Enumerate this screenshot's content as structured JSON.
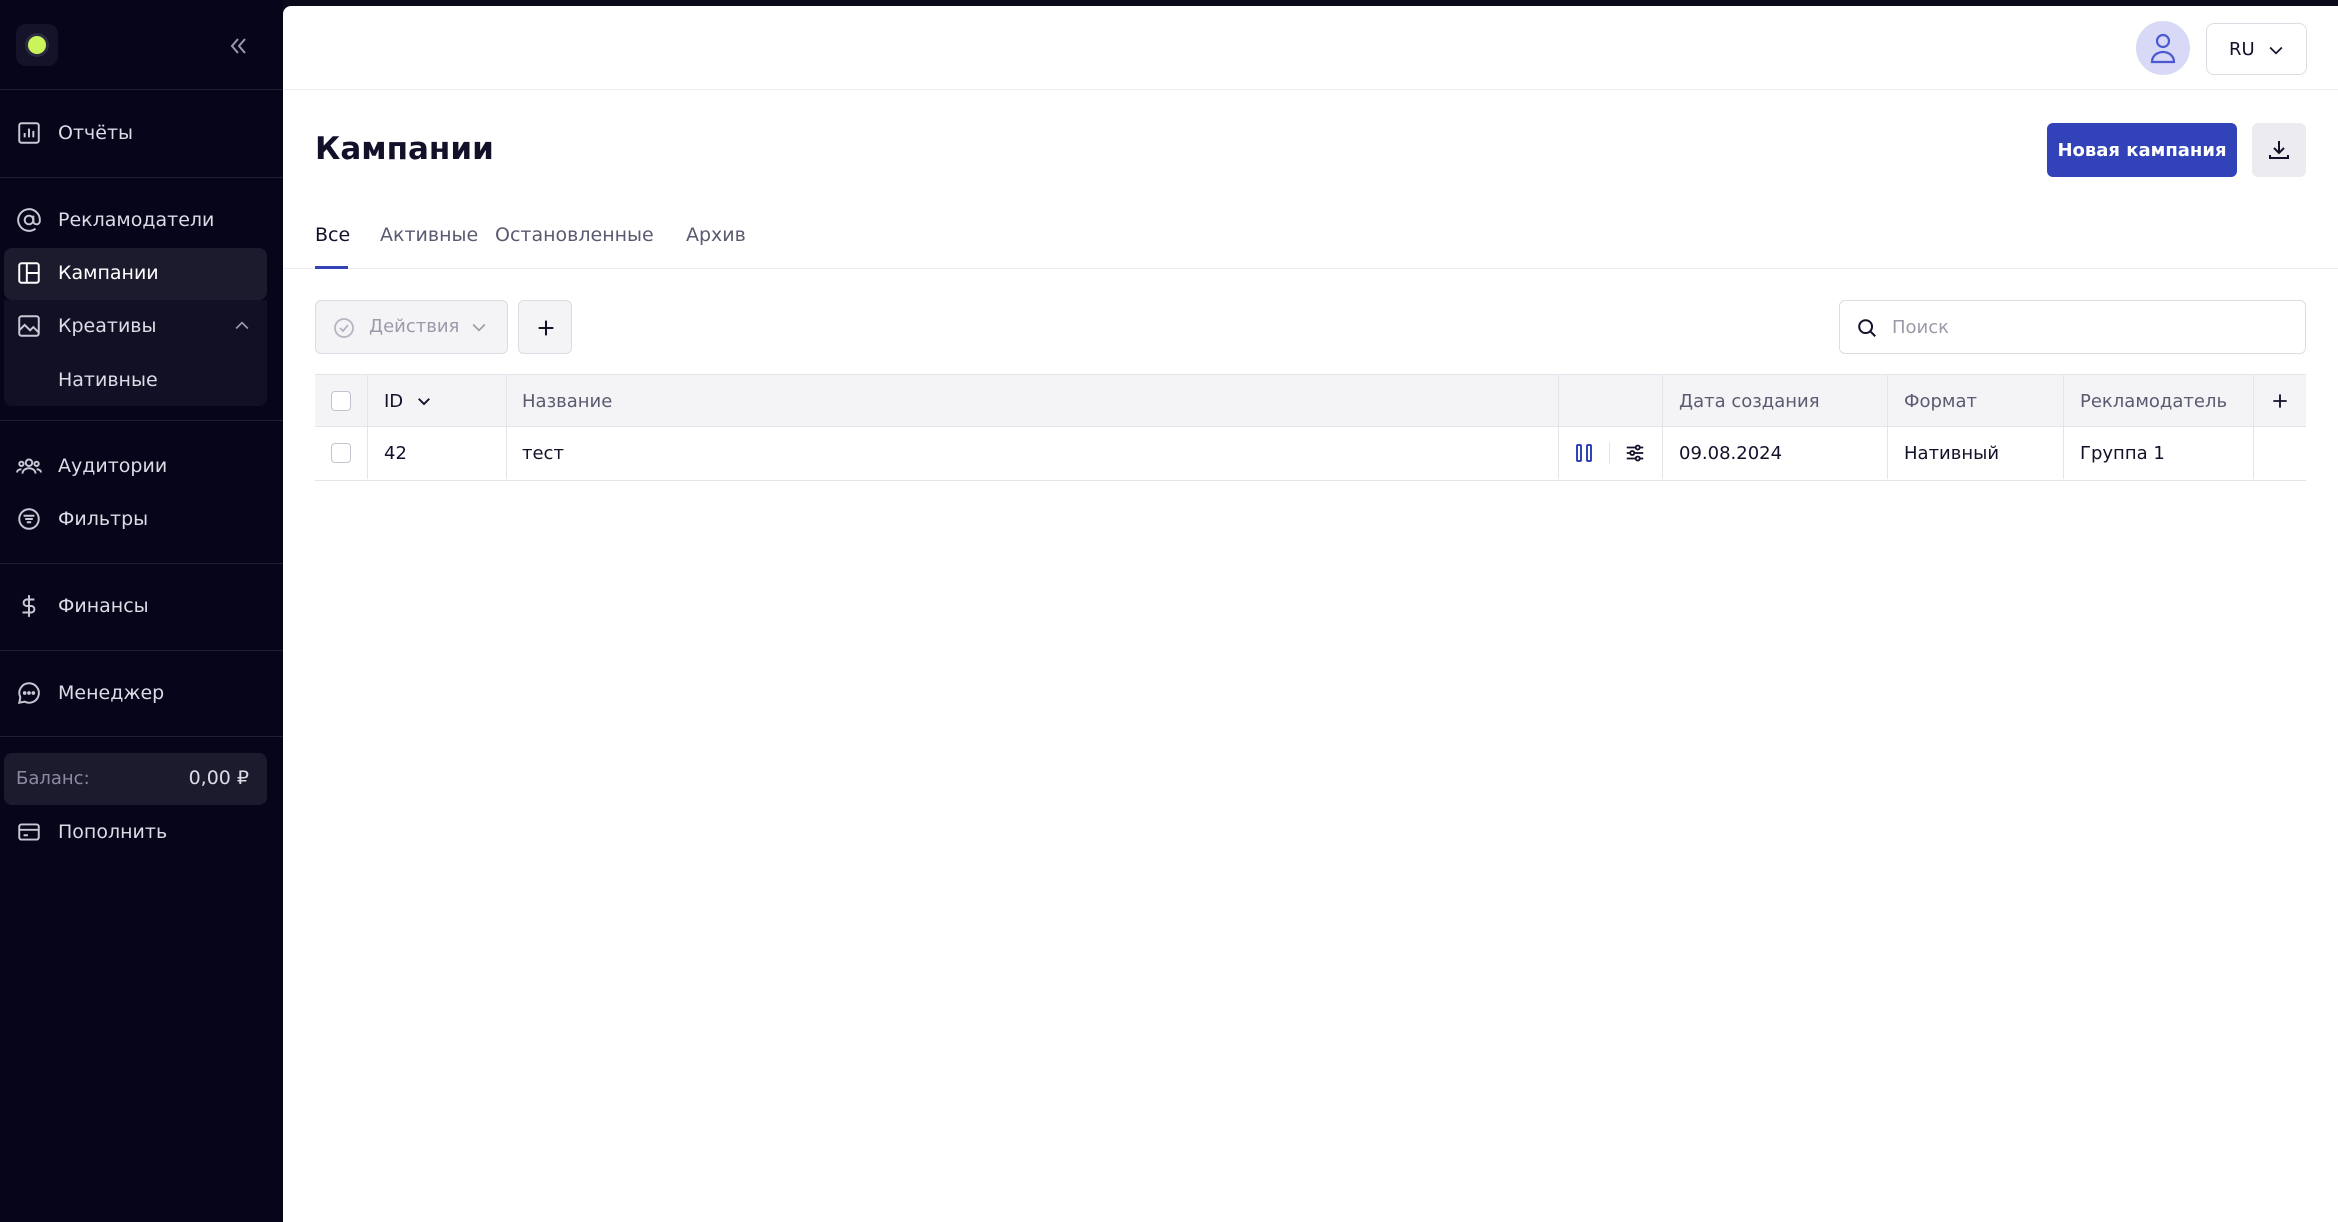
{
  "sidebar": {
    "items": [
      {
        "label": "Отчёты",
        "icon": "chart-icon"
      },
      {
        "label": "Рекламодатели",
        "icon": "at-icon"
      },
      {
        "label": "Кампании",
        "icon": "layout-icon"
      },
      {
        "label": "Креативы",
        "icon": "image-icon"
      },
      {
        "label": "Нативные"
      },
      {
        "label": "Аудитории",
        "icon": "users-icon"
      },
      {
        "label": "Фильтры",
        "icon": "filter-icon"
      },
      {
        "label": "Финансы",
        "icon": "dollar-icon"
      },
      {
        "label": "Менеджер",
        "icon": "chat-icon"
      }
    ],
    "balance_label": "Баланс:",
    "balance_value": "0,00 ₽",
    "topup_label": "Пополнить"
  },
  "header": {
    "lang": "RU"
  },
  "page": {
    "title": "Кампании",
    "new_button": "Новая кампания",
    "tabs": [
      "Все",
      "Активные",
      "Остановленные",
      "Архив"
    ],
    "actions_label": "Действия",
    "search_placeholder": "Поиск"
  },
  "table": {
    "columns": [
      "ID",
      "Название",
      "Дата создания",
      "Формат",
      "Рекламодатель"
    ],
    "rows": [
      {
        "id": "42",
        "name": "тест",
        "date": "09.08.2024",
        "format": "Нативный",
        "advertiser": "Группа 1"
      }
    ]
  },
  "colors": {
    "accent": "#3242b8",
    "sidebar_bg": "#06051a",
    "logo": "#c9f55a"
  }
}
